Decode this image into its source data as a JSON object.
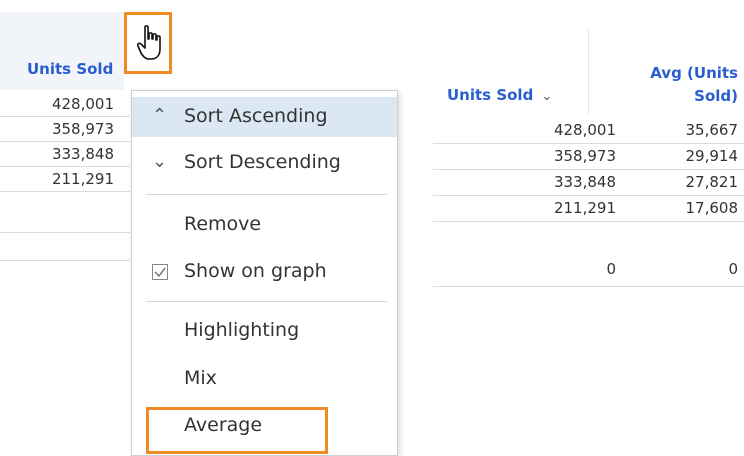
{
  "left_table": {
    "header": "Units Sold",
    "rows": [
      "428,001",
      "358,973",
      "333,848",
      "211,291"
    ]
  },
  "right_table": {
    "col1_header": "Units Sold",
    "col1_sort_icon": "chevron-down-icon",
    "col2_header_line1": "Avg (Units",
    "col2_header_line2": "Sold)",
    "rows": [
      {
        "units": "428,001",
        "avg": "35,667"
      },
      {
        "units": "358,973",
        "avg": "29,914"
      },
      {
        "units": "333,848",
        "avg": "27,821"
      },
      {
        "units": "211,291",
        "avg": "17,608"
      },
      {
        "units": "0",
        "avg": "0"
      }
    ]
  },
  "menu": {
    "sort_ascending": "Sort Ascending",
    "sort_descending": "Sort Descending",
    "remove": "Remove",
    "show_on_graph": "Show on graph",
    "highlighting": "Highlighting",
    "mix": "Mix",
    "average": "Average"
  },
  "colors": {
    "header_text": "#2a5ecf",
    "highlight_border": "#f08a24",
    "menu_active": "#dbe8f4"
  }
}
